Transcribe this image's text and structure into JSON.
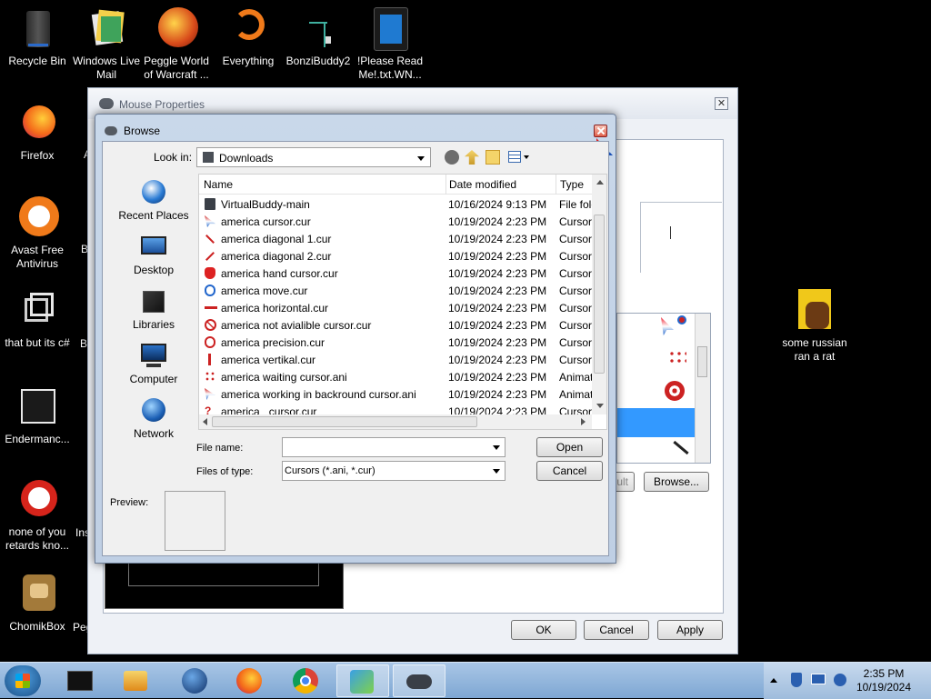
{
  "desktop": {
    "icons": [
      {
        "label": "Recycle Bin"
      },
      {
        "label": "Windows Live Mail"
      },
      {
        "label": "Peggle World of Warcraft ..."
      },
      {
        "label": "Everything"
      },
      {
        "label": "BonziBuddy2"
      },
      {
        "label": "!Please Read Me!.txt.WN..."
      },
      {
        "label": "Firefox"
      },
      {
        "label": "Avast Free Antivirus"
      },
      {
        "label": "that but its c#"
      },
      {
        "label": "Endermanc..."
      },
      {
        "label": "none of you retards kno..."
      },
      {
        "label": "ChomikBox"
      },
      {
        "label": "some russian ran a rat"
      }
    ],
    "partial_labels": {
      "a": "A",
      "b1": "B",
      "b2": "B",
      "ins": "Ins",
      "peg": "Peg"
    }
  },
  "mouse_properties": {
    "title": "Mouse Properties",
    "close_label": "✕",
    "browse_label": "Browse...",
    "use_default_partial": "ult",
    "ok_label": "OK",
    "cancel_label": "Cancel",
    "apply_label": "Apply"
  },
  "browse_dialog": {
    "title": "Browse",
    "look_in_label": "Look in:",
    "look_in_value": "Downloads",
    "places": [
      {
        "label": "Recent Places",
        "icon": "recent-places-icon"
      },
      {
        "label": "Desktop",
        "icon": "desktop-icon"
      },
      {
        "label": "Libraries",
        "icon": "libraries-icon"
      },
      {
        "label": "Computer",
        "icon": "computer-icon"
      },
      {
        "label": "Network",
        "icon": "network-icon"
      }
    ],
    "columns": {
      "name": "Name",
      "date": "Date modified",
      "type": "Type"
    },
    "files": [
      {
        "name": "VirtualBuddy-main",
        "date": "10/16/2024 9:13 PM",
        "type": "File folder",
        "icon": "folder-icon"
      },
      {
        "name": "america cursor.cur",
        "date": "10/19/2024 2:23 PM",
        "type": "Cursor",
        "icon": "arrow-cursor-icon"
      },
      {
        "name": "america diagonal 1.cur",
        "date": "10/19/2024 2:23 PM",
        "type": "Cursor",
        "icon": "diagonal-cursor-icon"
      },
      {
        "name": "america diagonal 2.cur",
        "date": "10/19/2024 2:23 PM",
        "type": "Cursor",
        "icon": "diagonal-cursor-icon"
      },
      {
        "name": "america hand cursor.cur",
        "date": "10/19/2024 2:23 PM",
        "type": "Cursor",
        "icon": "hand-cursor-icon"
      },
      {
        "name": "america move.cur",
        "date": "10/19/2024 2:23 PM",
        "type": "Cursor",
        "icon": "move-cursor-icon"
      },
      {
        "name": "america horizontal.cur",
        "date": "10/19/2024 2:23 PM",
        "type": "Cursor",
        "icon": "horizontal-cursor-icon"
      },
      {
        "name": "america not avialible cursor.cur",
        "date": "10/19/2024 2:23 PM",
        "type": "Cursor",
        "icon": "not-allowed-cursor-icon"
      },
      {
        "name": "america precision.cur",
        "date": "10/19/2024 2:23 PM",
        "type": "Cursor",
        "icon": "precision-cursor-icon"
      },
      {
        "name": "america vertikal.cur",
        "date": "10/19/2024 2:23 PM",
        "type": "Cursor",
        "icon": "vertical-cursor-icon"
      },
      {
        "name": "america waiting cursor.ani",
        "date": "10/19/2024 2:23 PM",
        "type": "Animated",
        "icon": "busy-cursor-icon"
      },
      {
        "name": "america working in backround cursor.ani",
        "date": "10/19/2024 2:23 PM",
        "type": "Animated",
        "icon": "working-cursor-icon"
      },
      {
        "name": "america _cursor.cur",
        "date": "10/19/2024 2:23 PM",
        "type": "Cursor",
        "icon": "help-cursor-icon"
      }
    ],
    "file_name_label": "File name:",
    "file_name_value": "",
    "files_of_type_label": "Files of type:",
    "files_of_type_value": "Cursors (*.ani, *.cur)",
    "open_label": "Open",
    "cancel_label": "Cancel",
    "preview_label": "Preview:"
  },
  "taskbar": {
    "time": "2:35 PM",
    "date": "10/19/2024"
  },
  "colors": {
    "selection": "#3399ff",
    "taskbar": "#8fb3da",
    "close_red": "#e0604a"
  }
}
